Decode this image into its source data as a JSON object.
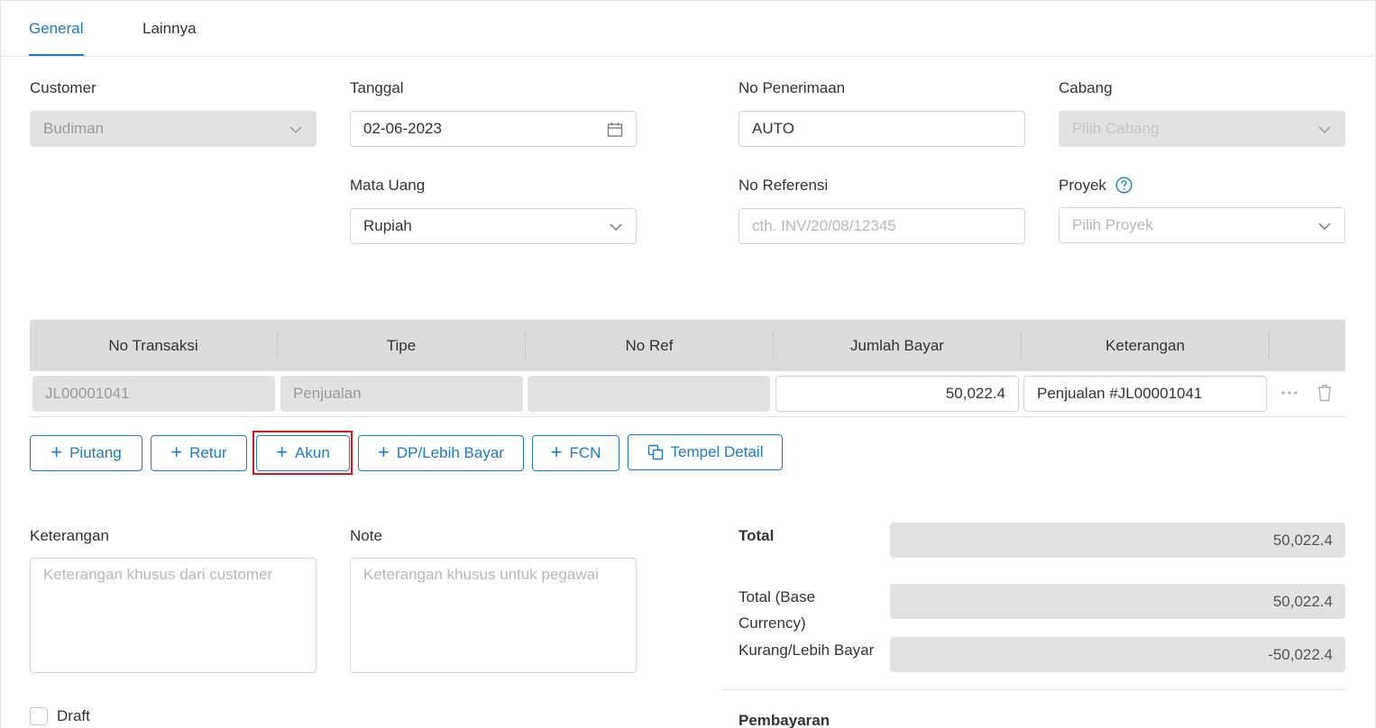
{
  "tabs": {
    "general": "General",
    "lainnya": "Lainnya"
  },
  "form": {
    "customer": {
      "label": "Customer",
      "value": "Budiman"
    },
    "tanggal": {
      "label": "Tanggal",
      "value": "02-06-2023"
    },
    "no_penerimaan": {
      "label": "No Penerimaan",
      "value": "AUTO"
    },
    "cabang": {
      "label": "Cabang",
      "placeholder": "Pilih Cabang"
    },
    "mata_uang": {
      "label": "Mata Uang",
      "value": "Rupiah"
    },
    "no_referensi": {
      "label": "No Referensi",
      "placeholder": "cth. INV/20/08/12345"
    },
    "proyek": {
      "label": "Proyek",
      "placeholder": "Pilih Proyek"
    }
  },
  "table": {
    "headers": [
      "No Transaksi",
      "Tipe",
      "No Ref",
      "Jumlah Bayar",
      "Keterangan"
    ],
    "rows": [
      {
        "no_transaksi": "JL00001041",
        "tipe": "Penjualan",
        "no_ref": "",
        "jumlah_bayar": "50,022.4",
        "keterangan": "Penjualan #JL00001041"
      }
    ]
  },
  "actions": {
    "piutang": "Piutang",
    "retur": "Retur",
    "akun": "Akun",
    "dp": "DP/Lebih Bayar",
    "fcn": "FCN",
    "tempel": "Tempel Detail"
  },
  "notes": {
    "keterangan_label": "Keterangan",
    "keterangan_placeholder": "Keterangan khusus dari customer",
    "note_label": "Note",
    "note_placeholder": "Keterangan khusus untuk pegawai"
  },
  "totals": {
    "total_label": "Total",
    "total_value": "50,022.4",
    "base_label_line1": "Total (Base",
    "base_label_line2": "Currency)",
    "base_value": "50,022.4",
    "kurang_label": "Kurang/Lebih Bayar",
    "kurang_value": "-50,022.4"
  },
  "draft_label": "Draft",
  "pembayaran_label": "Pembayaran",
  "colors": {
    "accent": "#1f78c8",
    "highlight": "#e0141c"
  }
}
